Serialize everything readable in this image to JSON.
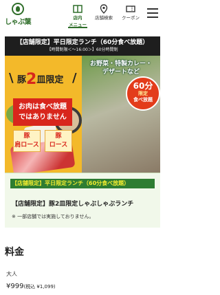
{
  "header": {
    "logo_text": "しゃぶ葉",
    "nav": [
      {
        "label": "店内\nメニュー",
        "label_line1": "店内",
        "label_line2": "メニュー",
        "active": true,
        "icon": "menu-book-icon"
      },
      {
        "label": "店舗検索",
        "icon": "map-pin-icon"
      },
      {
        "label": "クーポン",
        "icon": "coupon-icon"
      }
    ],
    "menu_icon": "hamburger-icon"
  },
  "banner": {
    "title": "【店舗限定】平日限定ランチ（60分食べ放題）",
    "subtitle": "【時間制限＜〜16:00＞】60分時間制"
  },
  "hero": {
    "pig_prefix": "豚",
    "pig_big": "2",
    "pig_suffix": "皿限定",
    "notice_line1": "お肉は食べ放題",
    "notice_line2": "ではありません",
    "cut1_line1": "豚",
    "cut1_line2": "肩ロース",
    "cut2_line1": "豚",
    "cut2_line2": "ロース",
    "photo_headline_line1": "お野菜・特製カレー・",
    "photo_headline_line2": "デザートなど",
    "burst_line1": "60分",
    "burst_line2": "限定",
    "burst_line3": "食べ放題"
  },
  "info": {
    "category": "【店舗限定】平日限定ランチ（60分食べ放題）",
    "item_name": "【店舗限定】豚2皿限定しゃぶしゃぶランチ",
    "note": "※ 一部店舗では実施しておりません。"
  },
  "price": {
    "heading": "料金",
    "tier_label": "大人",
    "amount": "¥999",
    "tax": "(税込 ¥1,099)"
  },
  "colors": {
    "brand_green": "#2f6e2a",
    "banner_dark": "#1e1e1e",
    "hero_yellow": "#f3b92a",
    "accent_red": "#d8261c",
    "bar_green": "#2e7d32",
    "bar_text_yellow": "#f2ec31"
  }
}
